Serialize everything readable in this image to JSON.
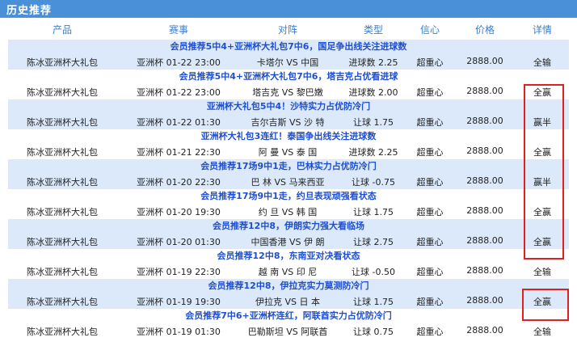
{
  "section_title": "历史推荐",
  "columns": [
    "产品",
    "赛事",
    "对阵",
    "类型",
    "信心",
    "价格",
    "详情"
  ],
  "rows": [
    {
      "title": "会员推荐5中4+亚洲杯大礼包7中6，国足争出线关注进球数",
      "product": "陈冰亚洲杯大礼包",
      "event": "亚洲杯 01-22 23:00",
      "match": "卡塔尔 VS 中国",
      "type": "进球数 2.25",
      "confidence": "超重心",
      "price": "2888.00",
      "detail": "全输"
    },
    {
      "title": "会员推荐5中4+亚洲杯大礼包7中6，塔吉克占优看进球",
      "product": "陈冰亚洲杯大礼包",
      "event": "亚洲杯 01-22 23:00",
      "match": "塔吉克 VS 黎巴嫩",
      "type": "进球数 2.00",
      "confidence": "超重心",
      "price": "2888.00",
      "detail": "全赢"
    },
    {
      "title": "亚洲杯大礼包5中4！沙特实力占优防冷门",
      "product": "陈冰亚洲杯大礼包",
      "event": "亚洲杯 01-22 01:30",
      "match": "吉尔吉斯 VS 沙 特",
      "type": "让球 1.75",
      "confidence": "超重心",
      "price": "2888.00",
      "detail": "赢半"
    },
    {
      "title": "亚洲杯大礼包3连红！泰国争出线关注进球数",
      "product": "陈冰亚洲杯大礼包",
      "event": "亚洲杯 01-21 22:30",
      "match": "阿 曼 VS 泰 国",
      "type": "进球数 2.25",
      "confidence": "超重心",
      "price": "2888.00",
      "detail": "全赢"
    },
    {
      "title": "会员推荐17场9中1走，巴林实力占优防冷门",
      "product": "陈冰亚洲杯大礼包",
      "event": "亚洲杯 01-20 22:30",
      "match": "巴 林 VS 马来西亚",
      "type": "让球 -0.75",
      "confidence": "超重心",
      "price": "2888.00",
      "detail": "赢半"
    },
    {
      "title": "会员推荐17场9中1走，约旦表现顽强看状态",
      "product": "陈冰亚洲杯大礼包",
      "event": "亚洲杯 01-20 19:30",
      "match": "约 旦 VS 韩 国",
      "type": "让球 1.75",
      "confidence": "超重心",
      "price": "2888.00",
      "detail": "全赢"
    },
    {
      "title": "会员推荐12中8，伊朗实力强大看临场",
      "product": "陈冰亚洲杯大礼包",
      "event": "亚洲杯 01-20 01:30",
      "match": "中国香港 VS 伊 朗",
      "type": "让球 2.75",
      "confidence": "超重心",
      "price": "2888.00",
      "detail": "全赢"
    },
    {
      "title": "会员推荐12中8，东南亚对决看状态",
      "product": "陈冰亚洲杯大礼包",
      "event": "亚洲杯 01-19 22:30",
      "match": "越 南 VS 印 尼",
      "type": "让球 -0.50",
      "confidence": "超重心",
      "price": "2888.00",
      "detail": "全输"
    },
    {
      "title": "会员推荐12中8，伊拉克实力莫测防冷门",
      "product": "陈冰亚洲杯大礼包",
      "event": "亚洲杯 01-19 19:30",
      "match": "伊拉克 VS 日 本",
      "type": "让球 1.75",
      "confidence": "超重心",
      "price": "2888.00",
      "detail": "全赢"
    },
    {
      "title": "会员推荐7中6+亚洲杯连红，阿联酋实力占优防冷门",
      "product": "陈冰亚洲杯大礼包",
      "event": "亚洲杯 01-19 01:30",
      "match": "巴勒斯坦 VS 阿联酋",
      "type": "让球 0.75",
      "confidence": "超重心",
      "price": "2888.00",
      "detail": "全输"
    }
  ],
  "colors": {
    "header": "#4a90d9",
    "shade": "#dbe9fb",
    "title_text": "#1f4fd0",
    "highlight_box": "#e02020"
  }
}
